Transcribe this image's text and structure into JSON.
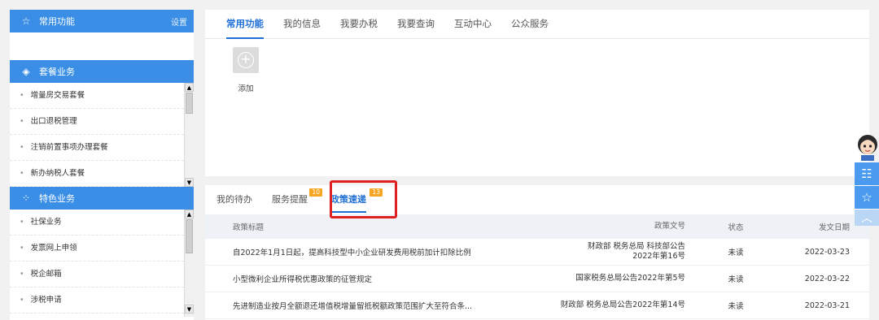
{
  "sidebar": {
    "common": {
      "title": "常用功能",
      "settings": "设置"
    },
    "package": {
      "title": "套餐业务",
      "items": [
        "增量房交易套餐",
        "出口退税管理",
        "注销前置事项办理套餐",
        "新办纳税人套餐"
      ]
    },
    "special": {
      "title": "特色业务",
      "items": [
        "社保业务",
        "发票网上申领",
        "税企邮箱",
        "涉税申请"
      ]
    }
  },
  "top_tabs": [
    "常用功能",
    "我的信息",
    "我要办税",
    "我要查询",
    "互动中心",
    "公众服务"
  ],
  "add_label": "添加",
  "bottom_tabs": [
    {
      "label": "我的待办",
      "badge": ""
    },
    {
      "label": "服务提醒",
      "badge": "10"
    },
    {
      "label": "政策速递",
      "badge": "13"
    }
  ],
  "table": {
    "headers": [
      "政策标题",
      "政策文号",
      "状态",
      "发文日期"
    ],
    "rows": [
      {
        "title": "自2022年1月1日起，提高科技型中小企业研发费用税前加计扣除比例",
        "doc_no": "财政部 税务总局 科技部公告2022年第16号",
        "status": "未读",
        "date": "2022-03-23"
      },
      {
        "title": "小型微利企业所得税优惠政策的征管规定",
        "doc_no": "国家税务总局公告2022年第5号",
        "status": "未读",
        "date": "2022-03-22"
      },
      {
        "title": "先进制造业按月全额退还增值税增量留抵税额政策范围扩大至符合条...",
        "doc_no": "财政部 税务总局公告2022年第14号",
        "status": "未读",
        "date": "2022-03-21"
      }
    ]
  },
  "colors": {
    "accent": "#3a8ee6",
    "active_tab": "#1f6fd6",
    "badge": "#f6a623",
    "highlight": "#e02020"
  },
  "icons": {
    "common": "star-outline-icon",
    "package": "cube-icon",
    "special": "grid-icon",
    "add": "plus-circle-icon"
  }
}
